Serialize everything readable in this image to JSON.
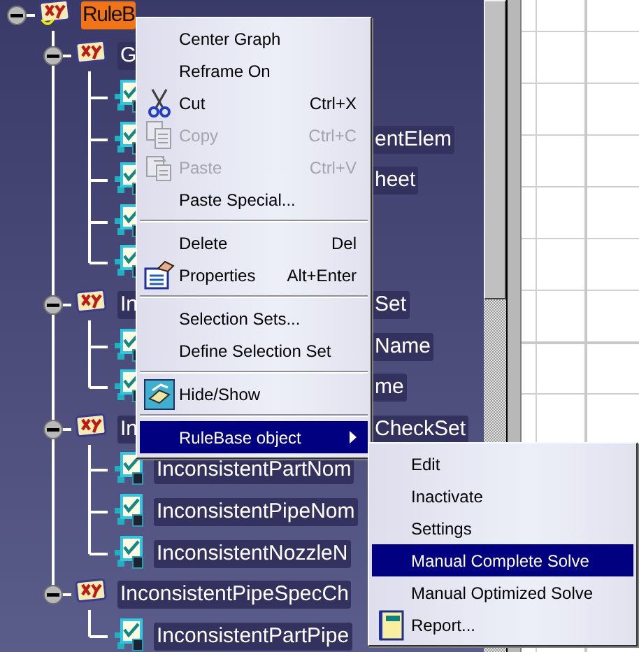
{
  "tree": [
    {
      "label": "RuleB",
      "kind": "rule_base",
      "selected": true,
      "expanded": true,
      "children": [
        {
          "label": "G",
          "kind": "rule_set",
          "selected": false,
          "expanded": true,
          "children": [
            {
              "kind": "check",
              "selected": false
            },
            {
              "label_end": "entElem",
              "kind": "check",
              "selected": false
            },
            {
              "label_end": "heet",
              "kind": "check",
              "selected": false
            },
            {
              "kind": "check",
              "selected": false
            },
            {
              "kind": "check",
              "selected": false
            }
          ]
        },
        {
          "label": "In",
          "label_end": "Set",
          "kind": "rule_set",
          "selected": false,
          "expanded": true,
          "children": [
            {
              "label_end": "Name",
              "kind": "check",
              "selected": false
            },
            {
              "label_end": "me",
              "kind": "check",
              "selected": false
            }
          ]
        },
        {
          "label": "In",
          "label_end": "CheckSet",
          "kind": "rule_set",
          "selected": false,
          "expanded": true,
          "children": [
            {
              "label": "InconsistentPartNom",
              "kind": "check",
              "selected": false
            },
            {
              "label": "InconsistentPipeNom",
              "kind": "check",
              "selected": false
            },
            {
              "label": "InconsistentNozzleN",
              "kind": "check",
              "selected": false
            }
          ]
        },
        {
          "label": "InconsistentPipeSpecCh",
          "kind": "rule_set",
          "selected": false,
          "expanded": true,
          "children": [
            {
              "label": "InconsistentPartPipe",
              "kind": "check",
              "selected": false
            }
          ]
        }
      ]
    }
  ],
  "context_menu": {
    "items": [
      {
        "kind": "item",
        "label": "Center Graph",
        "disabled": false,
        "selected": false
      },
      {
        "kind": "item",
        "label": "Reframe On",
        "disabled": false,
        "selected": false
      },
      {
        "kind": "item",
        "label": "Cut",
        "shortcut": "Ctrl+X",
        "disabled": false,
        "selected": false
      },
      {
        "kind": "item",
        "label": "Copy",
        "shortcut": "Ctrl+C",
        "disabled": true,
        "selected": false
      },
      {
        "kind": "item",
        "label": "Paste",
        "shortcut": "Ctrl+V",
        "disabled": true,
        "selected": false
      },
      {
        "kind": "item",
        "label": "Paste Special...",
        "disabled": false,
        "selected": false
      },
      {
        "kind": "separator"
      },
      {
        "kind": "item",
        "label": "Delete",
        "shortcut": "Del",
        "disabled": false,
        "selected": false
      },
      {
        "kind": "item",
        "label": "Properties",
        "shortcut": "Alt+Enter",
        "disabled": false,
        "selected": false
      },
      {
        "kind": "separator"
      },
      {
        "kind": "item",
        "label": "Selection Sets...",
        "disabled": false,
        "selected": false
      },
      {
        "kind": "item",
        "label": "Define Selection Set",
        "disabled": false,
        "selected": false
      },
      {
        "kind": "separator"
      },
      {
        "kind": "item",
        "label": "Hide/Show",
        "disabled": false,
        "selected": false
      },
      {
        "kind": "separator"
      },
      {
        "kind": "item",
        "label": "RuleBase object",
        "disabled": false,
        "selected": true,
        "submenu": true
      }
    ]
  },
  "submenu": {
    "items": [
      {
        "kind": "item",
        "label": "Edit",
        "disabled": false,
        "selected": false
      },
      {
        "kind": "item",
        "label": "Inactivate",
        "disabled": false,
        "selected": false
      },
      {
        "kind": "item",
        "label": "Settings",
        "disabled": false,
        "selected": false
      },
      {
        "kind": "item",
        "label": "Manual Complete Solve",
        "disabled": false,
        "selected": true
      },
      {
        "kind": "item",
        "label": "Manual Optimized Solve",
        "disabled": false,
        "selected": false
      },
      {
        "kind": "item",
        "label": "Report...",
        "disabled": false,
        "selected": false
      }
    ]
  }
}
